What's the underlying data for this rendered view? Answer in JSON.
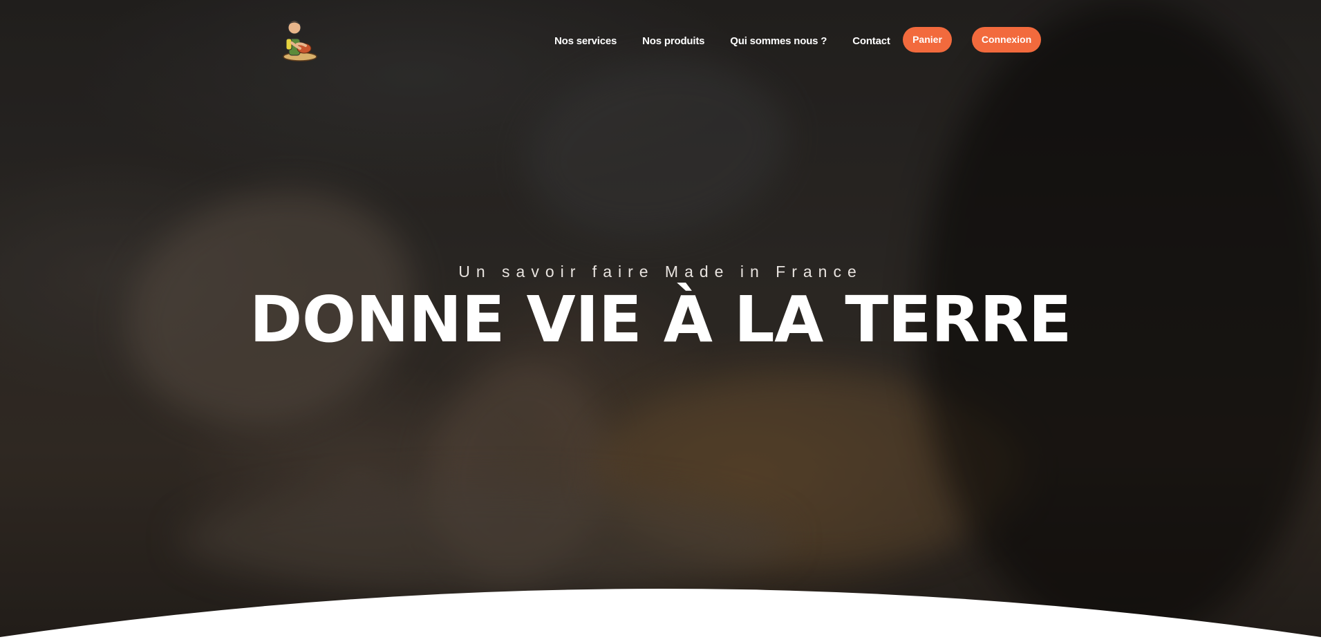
{
  "header": {
    "logo_alt": "Potter logo",
    "nav_links": [
      {
        "label": "Nos services"
      },
      {
        "label": "Nos produits"
      },
      {
        "label": "Qui sommes nous ?"
      },
      {
        "label": "Contact"
      }
    ],
    "cart_button": "Panier",
    "login_button": "Connexion"
  },
  "hero": {
    "subtitle": "Un savoir faire Made in France",
    "title": "DONNE VIE À LA TERRE",
    "accent_color": "#f26a3d"
  }
}
